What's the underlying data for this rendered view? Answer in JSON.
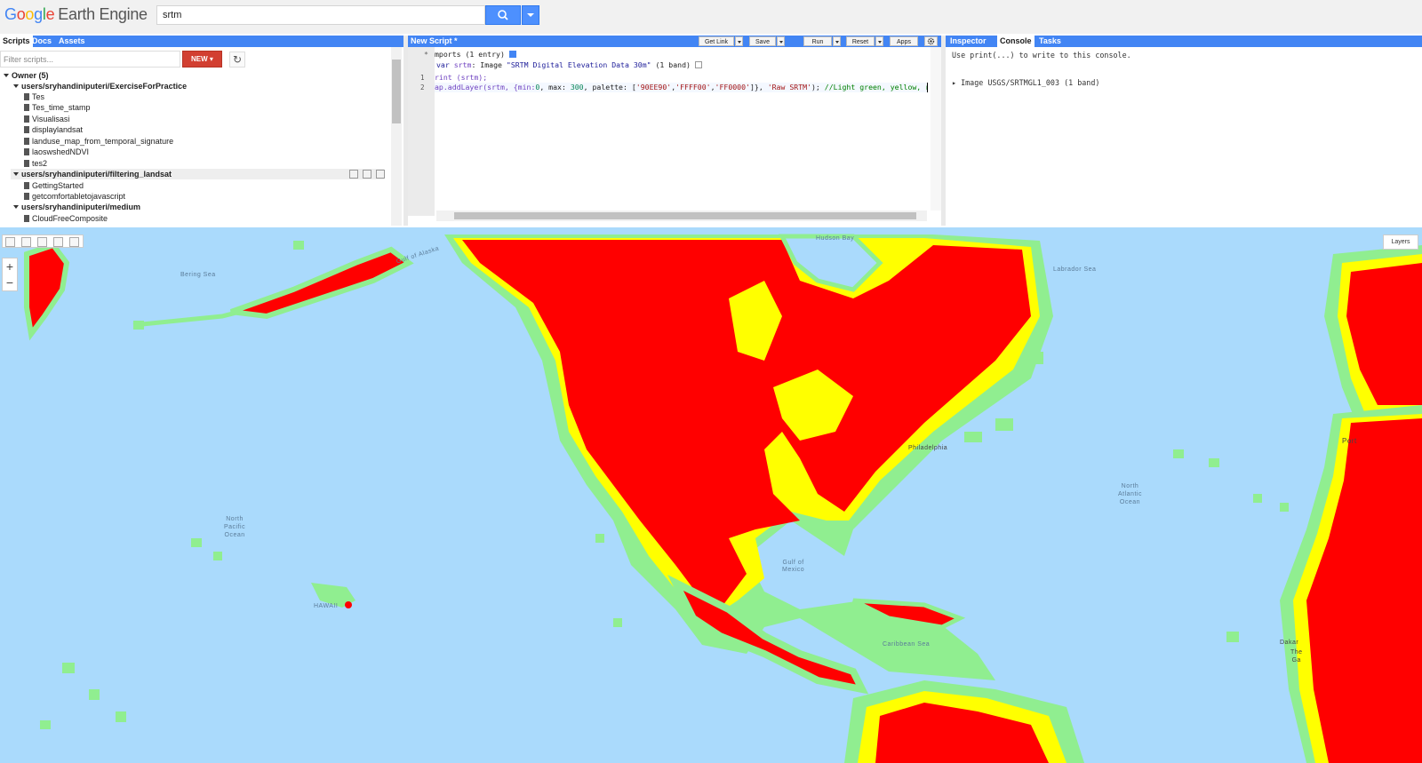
{
  "header": {
    "logo_google": [
      "G",
      "o",
      "o",
      "g",
      "l",
      "e"
    ],
    "logo_product": "Earth Engine",
    "search_value": "srtm"
  },
  "left_panel": {
    "tabs": [
      "Scripts",
      "Docs",
      "Assets"
    ],
    "filter_placeholder": "Filter scripts...",
    "new_button": "NEW",
    "tree": [
      {
        "label": "Owner (5)",
        "kind": "root"
      },
      {
        "label": "users/sryhandiniputeri/ExerciseForPractice",
        "kind": "folder"
      },
      {
        "label": "Tes",
        "kind": "file"
      },
      {
        "label": "Tes_time_stamp",
        "kind": "file"
      },
      {
        "label": "Visualisasi",
        "kind": "file"
      },
      {
        "label": "displaylandsat",
        "kind": "file"
      },
      {
        "label": "landuse_map_from_temporal_signature",
        "kind": "file"
      },
      {
        "label": "laoswshedNDVI",
        "kind": "file"
      },
      {
        "label": "tes2",
        "kind": "file"
      },
      {
        "label": "users/sryhandiniputeri/filtering_landsat",
        "kind": "folder"
      },
      {
        "label": "GettingStarted",
        "kind": "file"
      },
      {
        "label": "getcomfortabletojavascript",
        "kind": "file"
      },
      {
        "label": "users/sryhandiniputeri/medium",
        "kind": "folder"
      },
      {
        "label": "CloudFreeComposite",
        "kind": "file"
      }
    ]
  },
  "editor": {
    "title": "New Script *",
    "buttons": {
      "get_link": "Get Link",
      "save": "Save",
      "run": "Run",
      "reset": "Reset",
      "apps": "Apps"
    },
    "imports_line": "mports (1 entry)",
    "import_decl": {
      "keyword": "var",
      "name": "srtm",
      "type": ": Image ",
      "description": "\"SRTM Digital Elevation Data 30m\"",
      "bands": " (1 band)"
    },
    "line_numbers": [
      "1",
      "2"
    ],
    "line1": "rint (srtm);",
    "line2": {
      "a": "ap.addLayer(srtm, {min:",
      "n1": "0",
      "b": ", max: ",
      "n2": "300",
      "c": ", palette: [",
      "s1": "'90EE90'",
      "d": ",",
      "s2": "'FFFF00'",
      "e": ",",
      "s3": "'FF0000'",
      "f": "]}, ",
      "s4": "'Raw SRTM'",
      "g": "); ",
      "comment": "//Light green, yellow, red"
    }
  },
  "right_panel": {
    "tabs": [
      "Inspector",
      "Console",
      "Tasks"
    ],
    "hint": "Use print(...) to write to this console.",
    "output": "Image USGS/SRTMGL1_003 (1 band)"
  },
  "map": {
    "layers_button": "Layers",
    "zoom_in": "+",
    "zoom_out": "−",
    "labels": [
      {
        "text": "Hudson Bay"
      },
      {
        "text": "Labrador Sea"
      },
      {
        "text": "Gulf of Alaska"
      },
      {
        "text": "Bering Sea"
      },
      {
        "text": "North\nPacific\nOcean"
      },
      {
        "text": "North\nAtlantic\nOcean"
      },
      {
        "text": "Gulf of\nMexico"
      },
      {
        "text": "Caribbean Sea"
      },
      {
        "text": "HAWAII"
      },
      {
        "text": "Philadelphia"
      },
      {
        "text": "Port"
      },
      {
        "text": "Dakar"
      },
      {
        "text": "The\nGa"
      }
    ],
    "palette": [
      "#90EE90",
      "#FFFF00",
      "#FF0000"
    ],
    "ocean_color": "#aadafc"
  }
}
